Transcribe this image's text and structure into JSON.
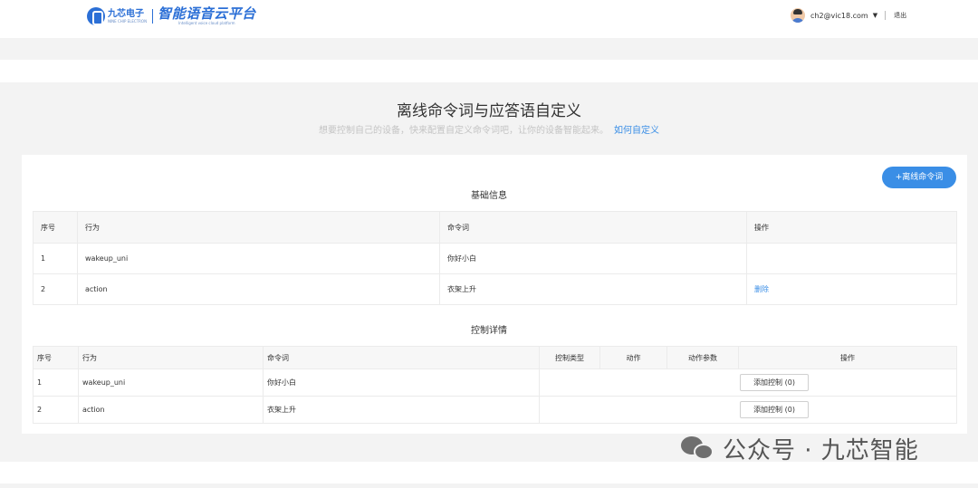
{
  "header": {
    "logo_cn": "九芯电子",
    "logo_en": "NINE CHIP ELECTRON",
    "platform_cn": "智能语音云平台",
    "platform_en": "Intelligent voice cloud platform",
    "user_email": "ch2@vic18.com",
    "caret": "▼",
    "logout": "退出"
  },
  "page": {
    "title": "离线命令词与应答语自定义",
    "subtitle": "想要控制自己的设备，快来配置自定义命令词吧，让你的设备智能起来。",
    "how_link": "如何自定义",
    "add_button": "+离线命令词"
  },
  "basic": {
    "title": "基础信息",
    "headers": [
      "序号",
      "行为",
      "命令词",
      "操作"
    ],
    "rows": [
      {
        "no": "1",
        "behavior": "wakeup_uni",
        "command": "你好小白",
        "op": ""
      },
      {
        "no": "2",
        "behavior": "action",
        "command": "衣架上升",
        "op": "删除"
      }
    ]
  },
  "control": {
    "title": "控制详情",
    "headers": [
      "序号",
      "行为",
      "命令词",
      "控制类型",
      "动作",
      "动作参数",
      "操作"
    ],
    "rows": [
      {
        "no": "1",
        "behavior": "wakeup_uni",
        "command": "你好小白",
        "button": "添加控制 (0)"
      },
      {
        "no": "2",
        "behavior": "action",
        "command": "衣架上升",
        "button": "添加控制 (0)"
      }
    ]
  },
  "watermark": {
    "text": "公众号 · 九芯智能",
    "icon": "wechat-icon"
  },
  "colors": {
    "accent": "#3a8ee6",
    "brand": "#2b6fd6",
    "background": "#f3f3f3"
  }
}
